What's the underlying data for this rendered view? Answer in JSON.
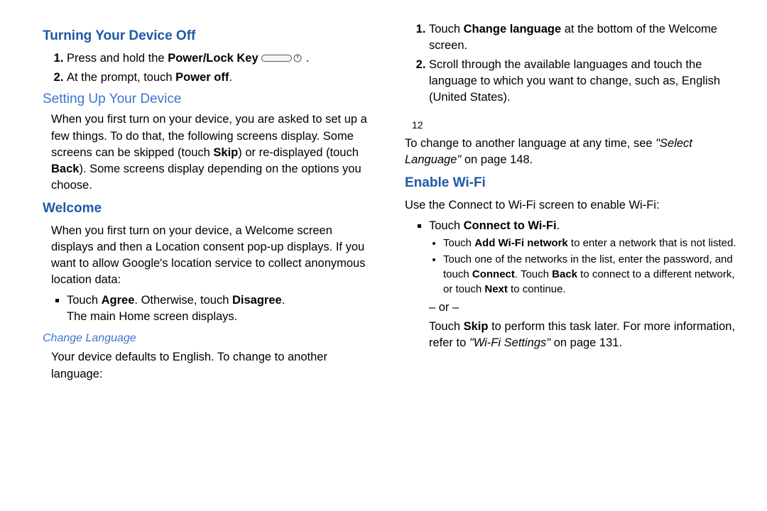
{
  "s1": {
    "heading": "Turning Your Device Off",
    "step1_a": "Press and hold the ",
    "step1_b": "Power/Lock Key",
    "step1_c": " .",
    "step2_a": "At the prompt, touch ",
    "step2_b": "Power off",
    "step2_c": "."
  },
  "s2": {
    "heading": "Setting Up Your Device",
    "p1_a": "When you first turn on your device, you are asked to set up a few things. To do that, the following screens display. Some screens can be skipped (touch ",
    "p1_b": "Skip",
    "p1_c": ") or re-displayed (touch ",
    "p1_d": "Back",
    "p1_e": "). Some screens display depending on the options you choose."
  },
  "s3": {
    "heading": "Welcome",
    "p1": "When you first turn on your device, a Welcome screen displays and then a Location consent pop-up displays. If you want to allow Google's location service to collect anonymous location data:",
    "b1_a": "Touch ",
    "b1_b": "Agree",
    "b1_c": ". Otherwise, touch ",
    "b1_d": "Disagree",
    "b1_e": ".",
    "b1_f": "The main Home screen displays."
  },
  "s4": {
    "heading": "Change Language",
    "p1": "Your device defaults to English. To change to another language:",
    "step1_a": "Touch ",
    "step1_b": "Change language",
    "step1_c": " at the bottom of the Welcome screen.",
    "step2": "Scroll through the available languages and touch the language to which you want to change, such as, English (United States).",
    "p2_a": "To change to another language at any time, see ",
    "p2_b": "\"Select Language\"",
    "p2_c": " on page 148."
  },
  "s5": {
    "heading": "Enable Wi-Fi",
    "p1": "Use the Connect to Wi-Fi screen to enable Wi-Fi:",
    "b1_a": "Touch ",
    "b1_b": "Connect to Wi-Fi",
    "b1_c": ".",
    "sub1_a": "Touch ",
    "sub1_b": "Add Wi-Fi network",
    "sub1_c": " to enter a network that is not listed.",
    "sub2_a": "Touch one of the networks in the list, enter the password, and touch ",
    "sub2_b": "Connect",
    "sub2_c": ". Touch ",
    "sub2_d": "Back",
    "sub2_e": " to connect to a different network, or touch ",
    "sub2_f": "Next",
    "sub2_g": " to continue.",
    "or": "– or –",
    "p2_a": "Touch ",
    "p2_b": "Skip",
    "p2_c": " to perform this task later. For more information, refer to ",
    "p2_d": "\"Wi-Fi Settings\" ",
    "p2_e": " on page 131."
  },
  "pagenum": "12"
}
